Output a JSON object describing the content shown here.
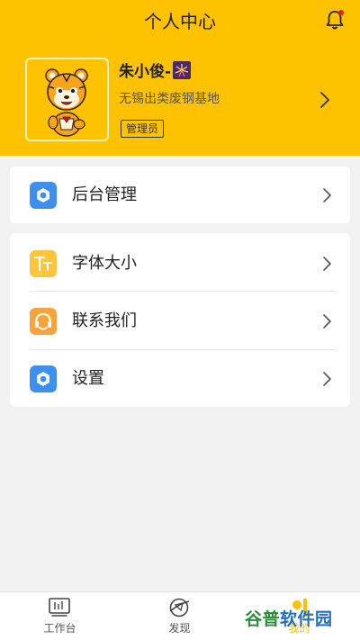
{
  "header": {
    "title": "个人中心"
  },
  "profile": {
    "name": "朱小俊-",
    "name_emoji_icon": "fireworks-icon",
    "company": "无锡出类废钢基地",
    "role_badge": "管理员"
  },
  "menu_group_1": [
    {
      "label": "后台管理",
      "icon": "gear-icon",
      "icon_color": "#3d8ff0"
    }
  ],
  "menu_group_2": [
    {
      "label": "字体大小",
      "icon": "font-size-icon",
      "icon_color": "#fcc53a"
    },
    {
      "label": "联系我们",
      "icon": "headset-icon",
      "icon_color": "#f9a43b"
    },
    {
      "label": "设置",
      "icon": "gear-icon",
      "icon_color": "#3d8ff0"
    }
  ],
  "tabbar": {
    "tabs": [
      {
        "label": "工作台",
        "icon": "workbench-icon"
      },
      {
        "label": "发现",
        "icon": "discover-icon"
      },
      {
        "label": "我的",
        "icon": "profile-icon"
      }
    ]
  },
  "watermark": {
    "part1": "谷普",
    "part2": "软件园"
  },
  "colors": {
    "brand_yellow": "#fec200",
    "background": "#f2f2f2"
  }
}
